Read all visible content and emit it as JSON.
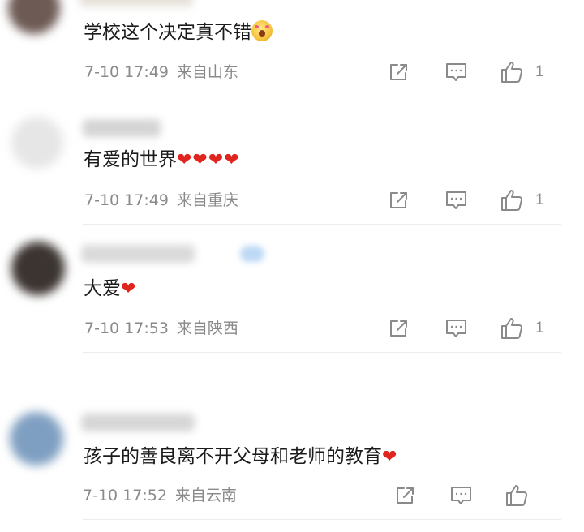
{
  "comments": [
    {
      "text": "学校这个决定真不错",
      "emoji": "surprised-face-emoji",
      "hearts": "",
      "time": "7-10 17:49",
      "location": "来自山东",
      "likes": "1"
    },
    {
      "text": "有爱的世界",
      "emoji": "",
      "hearts": "❤❤❤❤",
      "time": "7-10 17:49",
      "location": "来自重庆",
      "likes": "1"
    },
    {
      "text": "大爱",
      "emoji": "",
      "hearts": "❤",
      "time": "7-10 17:53",
      "location": "来自陕西",
      "likes": "1"
    },
    {
      "text": "孩子的善良离不开父母和老师的教育",
      "emoji": "",
      "hearts": "❤",
      "time": "7-10 17:52",
      "location": "来自云南",
      "likes": ""
    }
  ],
  "icons": {
    "share": "share-icon",
    "comment": "comment-icon",
    "like": "thumbs-up-icon"
  },
  "colors": {
    "text": "#1b1b1b",
    "meta": "#8a8a8a",
    "heart": "#e0241e",
    "divider": "#ececec"
  }
}
